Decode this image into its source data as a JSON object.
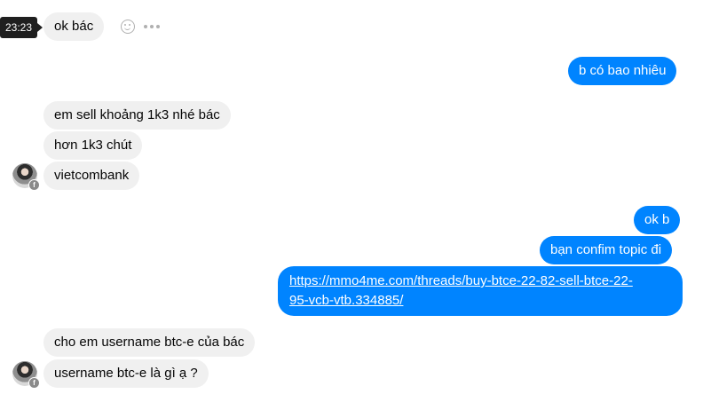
{
  "tooltip": {
    "time": "23:23"
  },
  "messages": {
    "m1": "ok bác",
    "m2": "b có bao nhiêu",
    "m3": "em sell khoảng 1k3 nhé bác",
    "m4": "hơn 1k3 chút",
    "m5": "vietcombank",
    "m6": "ok b",
    "m7": "bạn confim topic đi",
    "m8_line1": "https://mmo4me.com/threads/buy-btce-22-82-sell-btce-22-",
    "m8_line2": "95-vcb-vtb.334885/",
    "m9": "cho em username btc-e của bác",
    "m10": "username btc-e là gì ạ ?"
  },
  "icons": {
    "reaction": "emoji-smile-icon",
    "more": "more-options-icon",
    "badge": "facebook-badge-icon"
  },
  "colors": {
    "outgoing": "#0084ff",
    "incoming": "#f0f0f0",
    "tooltip": "#1f1f1f"
  }
}
